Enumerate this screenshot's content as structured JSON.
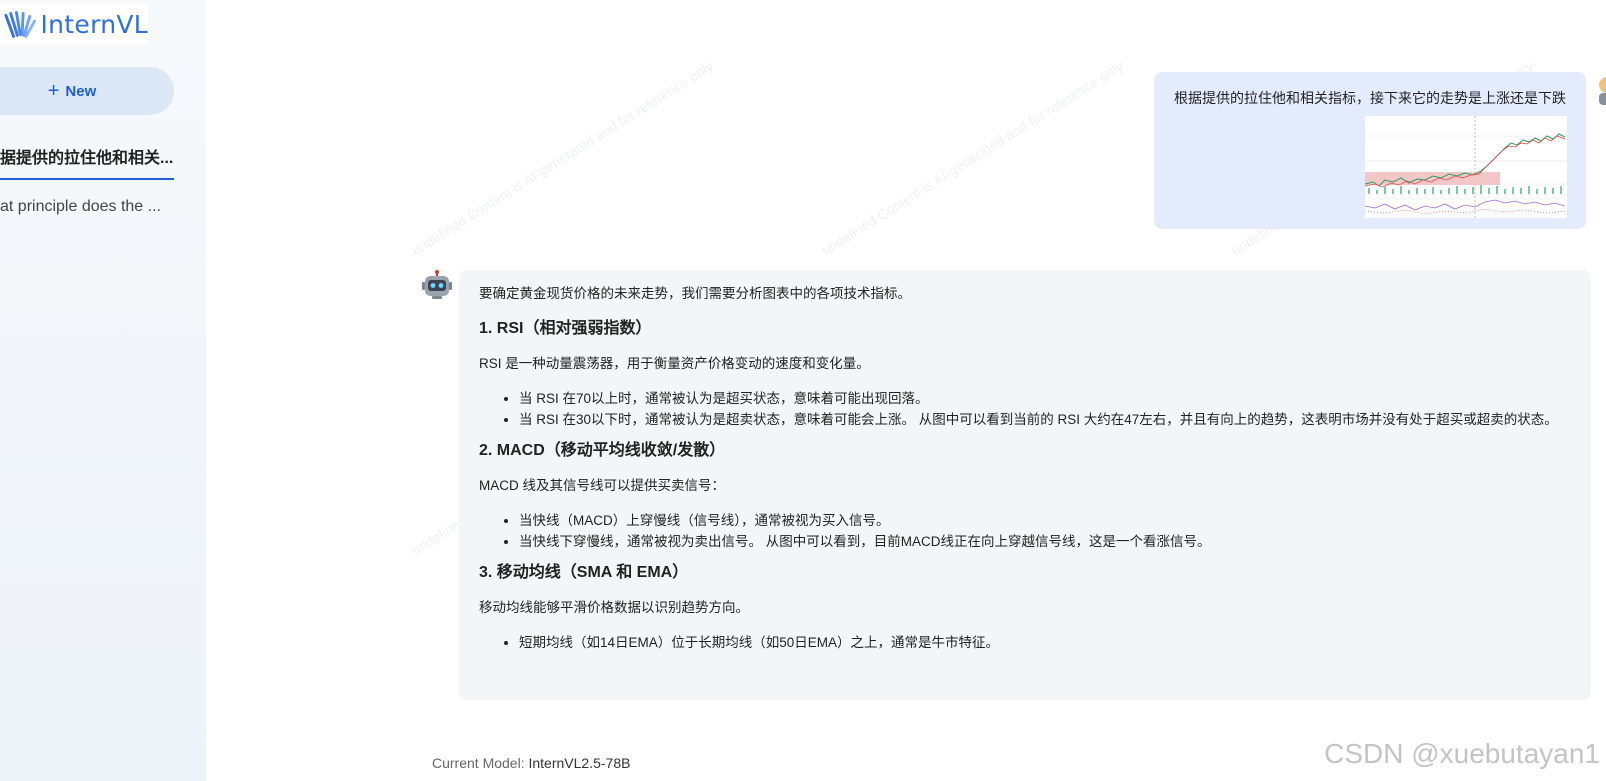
{
  "brand": {
    "name": "InternVL",
    "color": "#2f6fe0"
  },
  "sidebar": {
    "new_button": "New",
    "conversations": [
      {
        "label": "据提供的拉住他和相关...",
        "active": true
      },
      {
        "label": "at principle does the ...",
        "active": false
      }
    ]
  },
  "watermark_text": "undefined Content is AI-generated and for reference only",
  "messages": {
    "user": {
      "text": "根据提供的拉住他和相关指标，接下来它的走势是上涨还是下跌",
      "bubble_color": "#e3ebfc"
    },
    "bot": {
      "bubble_color": "#f3f5f8",
      "intro": "要确定黄金现货价格的未来走势，我们需要分析图表中的各项技术指标。",
      "sections": [
        {
          "heading": "1. RSI（相对强弱指数）",
          "desc": "RSI 是一种动量震荡器，用于衡量资产价格变动的速度和变化量。",
          "bullets": [
            "当 RSI 在70以上时，通常被认为是超买状态，意味着可能出现回落。",
            "当 RSI 在30以下时，通常被认为是超卖状态，意味着可能会上涨。 从图中可以看到当前的 RSI 大约在47左右，并且有向上的趋势，这表明市场并没有处于超买或超卖的状态。"
          ]
        },
        {
          "heading": "2. MACD（移动平均线收敛/发散）",
          "desc": "MACD 线及其信号线可以提供买卖信号：",
          "bullets": [
            "当快线（MACD）上穿慢线（信号线），通常被视为买入信号。",
            "当快线下穿慢线，通常被视为卖出信号。 从图中可以看到，目前MACD线正在向上穿越信号线，这是一个看涨信号。"
          ]
        },
        {
          "heading": "3. 移动均线（SMA 和 EMA）",
          "desc": "移动均线能够平滑价格数据以识别趋势方向。",
          "bullets": [
            "短期均线（如14日EMA）位于长期均线（如50日EMA）之上，通常是牛市特征。"
          ]
        }
      ]
    }
  },
  "footer": {
    "model_label": "Current Model:",
    "model_name": "InternVL2.5-78B"
  },
  "csdn_watermark": "CSDN @xuebutayan1"
}
